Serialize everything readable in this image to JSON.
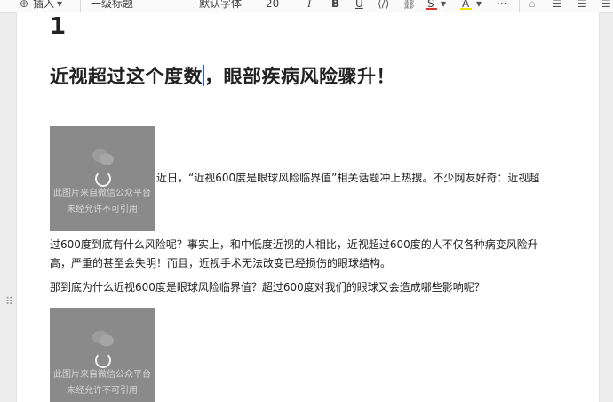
{
  "toolbar": {
    "insert_label": "插入",
    "heading_label": "一级标题",
    "font_label": "默认字体",
    "size_label": "20",
    "italic": "I",
    "bold": "B",
    "underline": "U",
    "strike": "S",
    "highlight": "A",
    "more": "···",
    "colors": {
      "font_red": "#e03131",
      "highlight_yellow": "#f5e400"
    }
  },
  "doc": {
    "heading_number": "1",
    "title_before_cursor": "近视超过这个度数",
    "title_after_cursor": "，眼部疾病风险骤升！",
    "image_watermark": [
      "此图片来自微信公众平台",
      "未经允许不可引用"
    ],
    "para1_inline": "近日，“近视600度是眼球风险临界值”相关话题冲上热搜。不少网友好奇：近视超",
    "para1_line2": "过600度到底有什么风险呢？事实上，和中低度近视的人相比，近视超过600度的人不仅各种病变风险升",
    "para1_line3": "高，严重的甚至会失明！而且，近视手术无法改变已经损伤的眼球结构。",
    "para2": "那到底为什么近视600度是眼球风险临界值？超过600度对我们的眼球又会造成哪些影响呢？"
  }
}
